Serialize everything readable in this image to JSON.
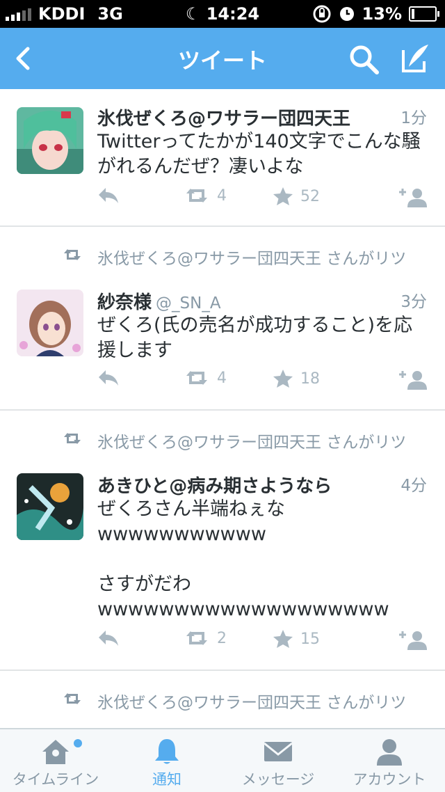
{
  "status_bar": {
    "carrier": "KDDI",
    "network": "3G",
    "time": "14:24",
    "battery": "13%",
    "battery_level": 0.13
  },
  "nav": {
    "title": "ツイート"
  },
  "colors": {
    "brand": "#55acee",
    "muted": "#8899a6",
    "icon": "#aab8c2"
  },
  "tweets": [
    {
      "name": "氷伐ぜくろ@ワサラー団四天王",
      "handle": "",
      "time": "1分",
      "text": "Twitterってたかが140文字でこんな騒がれるんだぜ？凄いよな",
      "retweets": "4",
      "favorites": "52"
    },
    {
      "retweeted_by": "氷伐ぜくろ@ワサラー団四天王 さんがリツ",
      "name": "紗奈様",
      "handle": "@_SN_A",
      "time": "3分",
      "text": "ぜくろ(氏の売名が成功すること)を応援します",
      "retweets": "4",
      "favorites": "18"
    },
    {
      "retweeted_by": "氷伐ぜくろ@ワサラー団四天王 さんがリツ",
      "name": "あきひと@病み期さようなら",
      "handle": "",
      "time": "4分",
      "text": "ぜくろさん半端ねぇな\nwwwwwwwwwww\n\nさすがだわ\nwwwwwwwwwwwwwwwwwww",
      "retweets": "2",
      "favorites": "15"
    },
    {
      "retweeted_by": "氷伐ぜくろ@ワサラー団四天王 さんがリツ"
    }
  ],
  "tabs": [
    {
      "label": "タイムライン",
      "icon": "home-icon"
    },
    {
      "label": "通知",
      "icon": "bell-icon"
    },
    {
      "label": "メッセージ",
      "icon": "envelope-icon"
    },
    {
      "label": "アカウント",
      "icon": "person-icon"
    }
  ]
}
